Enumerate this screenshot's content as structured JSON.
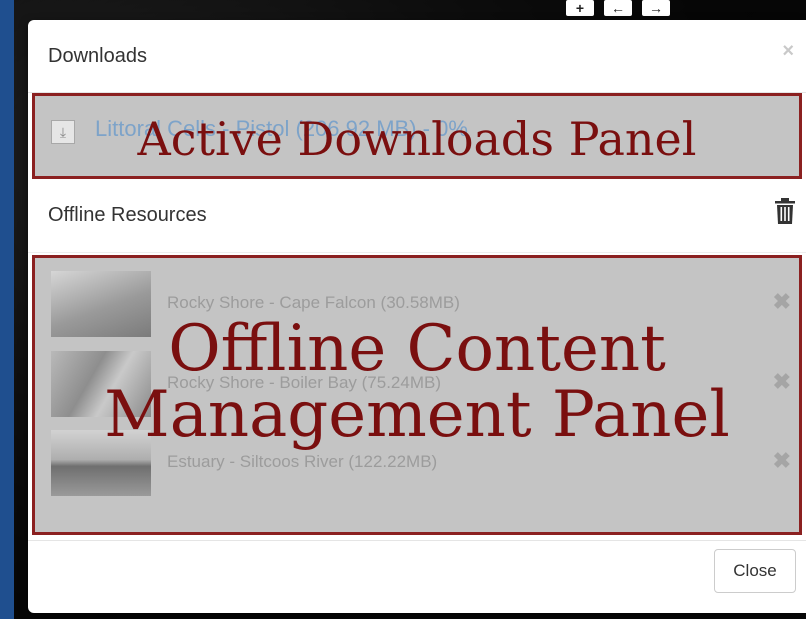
{
  "background": {
    "map_controls": [
      "+",
      "←",
      "→"
    ]
  },
  "modal": {
    "title": "Downloads",
    "close_glyph": "×"
  },
  "active_downloads": {
    "item_text": "Littoral Cells - Pistol (206.92 MB) - 0%",
    "overlay_label": "Active Downloads Panel",
    "download_icon": "download-icon"
  },
  "offline_resources": {
    "title": "Offline Resources",
    "trash_icon": "trash-icon",
    "items": [
      {
        "label": "Rocky Shore - Cape Falcon (30.58MB)",
        "remove": "✖"
      },
      {
        "label": "Rocky Shore - Boiler Bay (75.24MB)",
        "remove": "✖"
      },
      {
        "label": "Estuary - Siltcoos River (122.22MB)",
        "remove": "✖"
      }
    ],
    "overlay_line1": "Offline Content",
    "overlay_line2": "Management Panel"
  },
  "footer": {
    "close_label": "Close"
  },
  "colors": {
    "annotation_border": "#8b2020",
    "annotation_text": "#7a0f0f",
    "panel_fill": "#c4c4c4"
  }
}
